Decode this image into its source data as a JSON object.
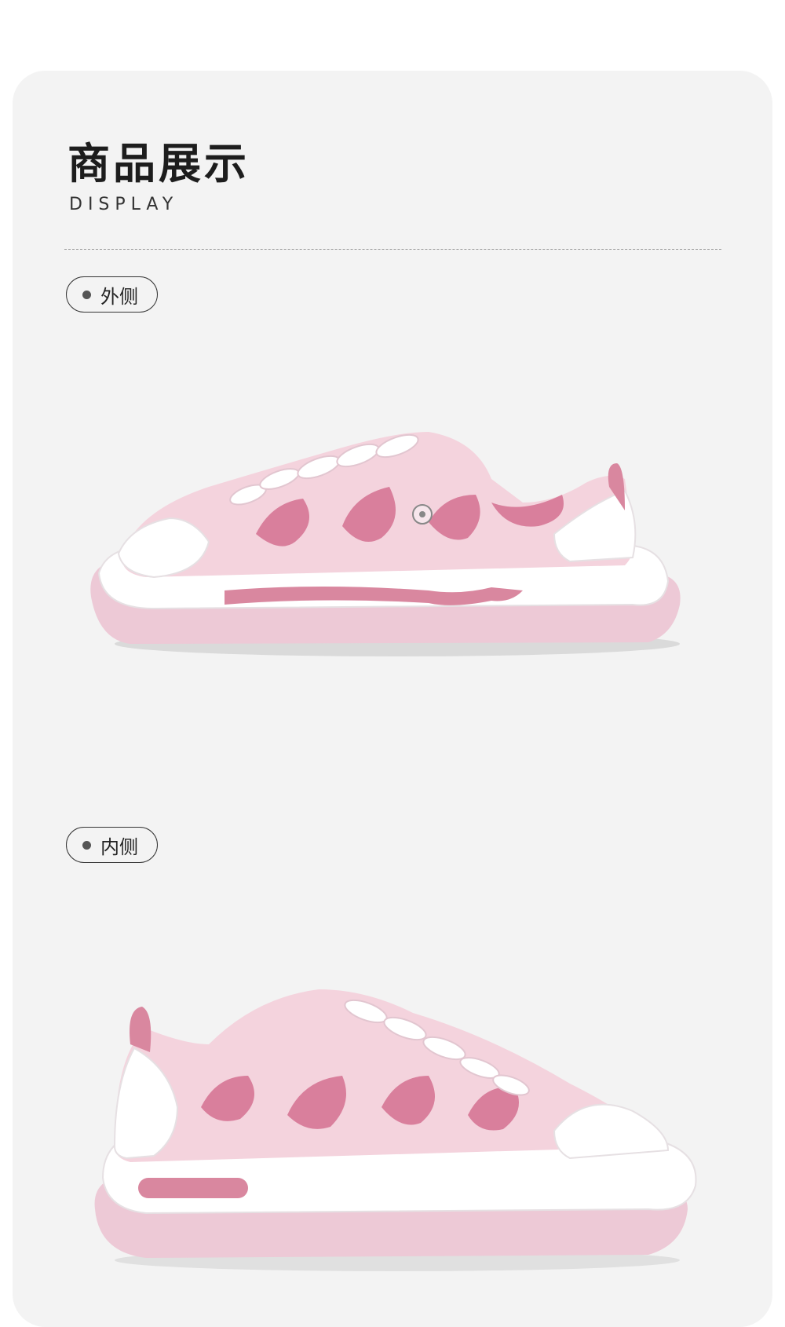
{
  "header": {
    "title": "商品展示",
    "subtitle": "DISPLAY"
  },
  "sections": [
    {
      "label": "外侧"
    },
    {
      "label": "内侧"
    }
  ],
  "colors": {
    "card_bg": "#f3f3f3",
    "shoe_pink": "#f2c6d3",
    "shoe_dark_pink": "#d97f9c",
    "sole_white": "#ffffff",
    "outsole_pink": "#edc9d6"
  }
}
